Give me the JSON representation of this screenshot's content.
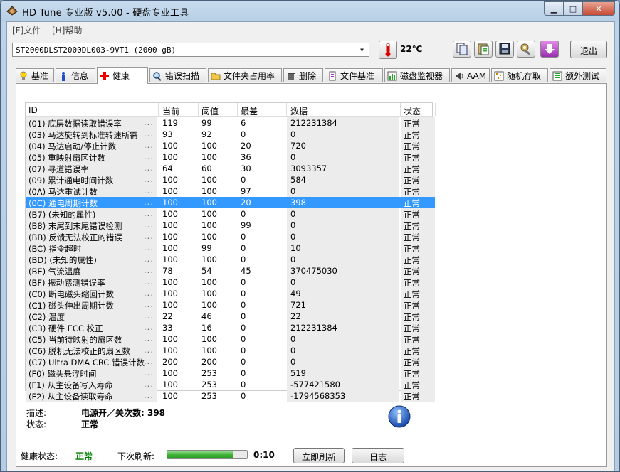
{
  "window": {
    "title": "HD Tune 专业版 v5.00 - 硬盘专业工具",
    "min_glyph": "▁",
    "max_glyph": "□",
    "close_glyph": "✕"
  },
  "menu": [
    {
      "label": "[F]文件"
    },
    {
      "label": "[H]帮助"
    }
  ],
  "toolbar": {
    "drive": "ST2000DLST2000DL003-9VT1 (2000 gB)",
    "temperature": "22℃",
    "exit_label": "退出"
  },
  "tabs": [
    {
      "label": "基准"
    },
    {
      "label": "信息"
    },
    {
      "label": "健康"
    },
    {
      "label": "错误扫描"
    },
    {
      "label": "文件夹占用率"
    },
    {
      "label": "删除"
    },
    {
      "label": "文件基准"
    },
    {
      "label": "磁盘监视器"
    },
    {
      "label": "AAM"
    },
    {
      "label": "随机存取"
    },
    {
      "label": "额外测试"
    }
  ],
  "active_tab": "健康",
  "table": {
    "columns": [
      "ID",
      "当前",
      "阈值",
      "最差",
      "数据",
      "状态"
    ],
    "selected_index": 7,
    "rows": [
      {
        "id": "(01) 底层数据读取错误率",
        "cur": "119",
        "thr": "99",
        "worst": "6",
        "data": "212231384",
        "status": "正常"
      },
      {
        "id": "(03) 马达旋转到标准转速所需",
        "cur": "93",
        "thr": "92",
        "worst": "0",
        "data": "0",
        "status": "正常"
      },
      {
        "id": "(04) 马达启动/停止计数",
        "cur": "100",
        "thr": "100",
        "worst": "20",
        "data": "720",
        "status": "正常"
      },
      {
        "id": "(05) 重映射扇区计数",
        "cur": "100",
        "thr": "100",
        "worst": "36",
        "data": "0",
        "status": "正常"
      },
      {
        "id": "(07) 寻道错误率",
        "cur": "64",
        "thr": "60",
        "worst": "30",
        "data": "3093357",
        "status": "正常"
      },
      {
        "id": "(09) 累计通电时间计数",
        "cur": "100",
        "thr": "100",
        "worst": "0",
        "data": "584",
        "status": "正常"
      },
      {
        "id": "(0A) 马达重试计数",
        "cur": "100",
        "thr": "100",
        "worst": "97",
        "data": "0",
        "status": "正常"
      },
      {
        "id": "(0C) 通电周期计数",
        "cur": "100",
        "thr": "100",
        "worst": "20",
        "data": "398",
        "status": "正常"
      },
      {
        "id": "(B7) (未知的属性)",
        "cur": "100",
        "thr": "100",
        "worst": "0",
        "data": "0",
        "status": "正常"
      },
      {
        "id": "(B8) 末尾到末尾错误检测",
        "cur": "100",
        "thr": "100",
        "worst": "99",
        "data": "0",
        "status": "正常"
      },
      {
        "id": "(BB) 反馈无法校正的错误",
        "cur": "100",
        "thr": "100",
        "worst": "0",
        "data": "0",
        "status": "正常"
      },
      {
        "id": "(BC) 指令超时",
        "cur": "100",
        "thr": "99",
        "worst": "0",
        "data": "10",
        "status": "正常"
      },
      {
        "id": "(BD) (未知的属性)",
        "cur": "100",
        "thr": "100",
        "worst": "0",
        "data": "0",
        "status": "正常"
      },
      {
        "id": "(BE) 气流温度",
        "cur": "78",
        "thr": "54",
        "worst": "45",
        "data": "370475030",
        "status": "正常"
      },
      {
        "id": "(BF) 振动感测错误率",
        "cur": "100",
        "thr": "100",
        "worst": "0",
        "data": "0",
        "status": "正常"
      },
      {
        "id": "(C0) 断电磁头缩回计数",
        "cur": "100",
        "thr": "100",
        "worst": "0",
        "data": "49",
        "status": "正常"
      },
      {
        "id": "(C1) 磁头伸出周期计数",
        "cur": "100",
        "thr": "100",
        "worst": "0",
        "data": "721",
        "status": "正常"
      },
      {
        "id": "(C2) 温度",
        "cur": "22",
        "thr": "46",
        "worst": "0",
        "data": "22",
        "status": "正常"
      },
      {
        "id": "(C3) 硬件 ECC 校正",
        "cur": "33",
        "thr": "16",
        "worst": "0",
        "data": "212231384",
        "status": "正常"
      },
      {
        "id": "(C5) 当前待映射的扇区数",
        "cur": "100",
        "thr": "100",
        "worst": "0",
        "data": "0",
        "status": "正常"
      },
      {
        "id": "(C6) 脱机无法校正的扇区数",
        "cur": "100",
        "thr": "100",
        "worst": "0",
        "data": "0",
        "status": "正常"
      },
      {
        "id": "(C7) Ultra DMA CRC 错误计数",
        "cur": "200",
        "thr": "200",
        "worst": "0",
        "data": "0",
        "status": "正常"
      },
      {
        "id": "(F0) 磁头悬浮时间",
        "cur": "100",
        "thr": "253",
        "worst": "0",
        "data": "519",
        "status": "正常"
      },
      {
        "id": "(F1) 从主设备写入寿命",
        "cur": "100",
        "thr": "253",
        "worst": "0",
        "data": "-577421580",
        "status": "正常"
      },
      {
        "id": "(F2) 从主设备读取寿命",
        "cur": "100",
        "thr": "253",
        "worst": "0",
        "data": "-1794568353",
        "status": "正常"
      }
    ]
  },
  "details": {
    "desc_label": "描述:",
    "desc_value": "电源开／关次数: 398",
    "status_label": "状态:",
    "status_value": "正常"
  },
  "footer": {
    "health_label": "健康状态:",
    "health_value": "正常",
    "health_color": "#008000",
    "refresh_label": "下次刷新:",
    "progress_fraction": 0.82,
    "countdown": "0:10",
    "refresh_button": "立即刷新",
    "log_button": "日志"
  }
}
